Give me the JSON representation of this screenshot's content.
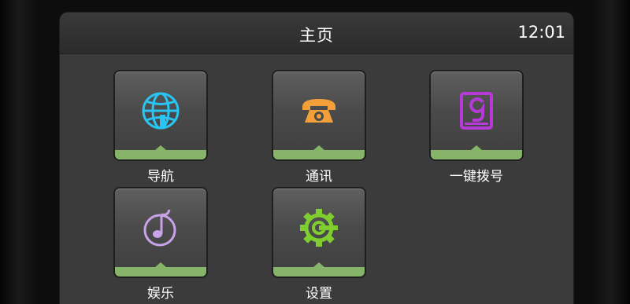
{
  "header": {
    "title": "主页",
    "time": "12:01"
  },
  "apps": [
    {
      "label": "导航",
      "icon": "globe-navigation-icon",
      "color": "#29c4f2"
    },
    {
      "label": "通讯",
      "icon": "telephone-icon",
      "color": "#f3a03a"
    },
    {
      "label": "一键拨号",
      "icon": "speed-dial-9-icon",
      "color": "#b53ad8"
    },
    {
      "label": "娱乐",
      "icon": "music-note-icon",
      "color": "#c9a3ea"
    },
    {
      "label": "设置",
      "icon": "settings-gear-icon",
      "color": "#7fcd2f"
    }
  ],
  "colors": {
    "tile_accent": "#86b56a",
    "background": "#3b3b3b"
  }
}
